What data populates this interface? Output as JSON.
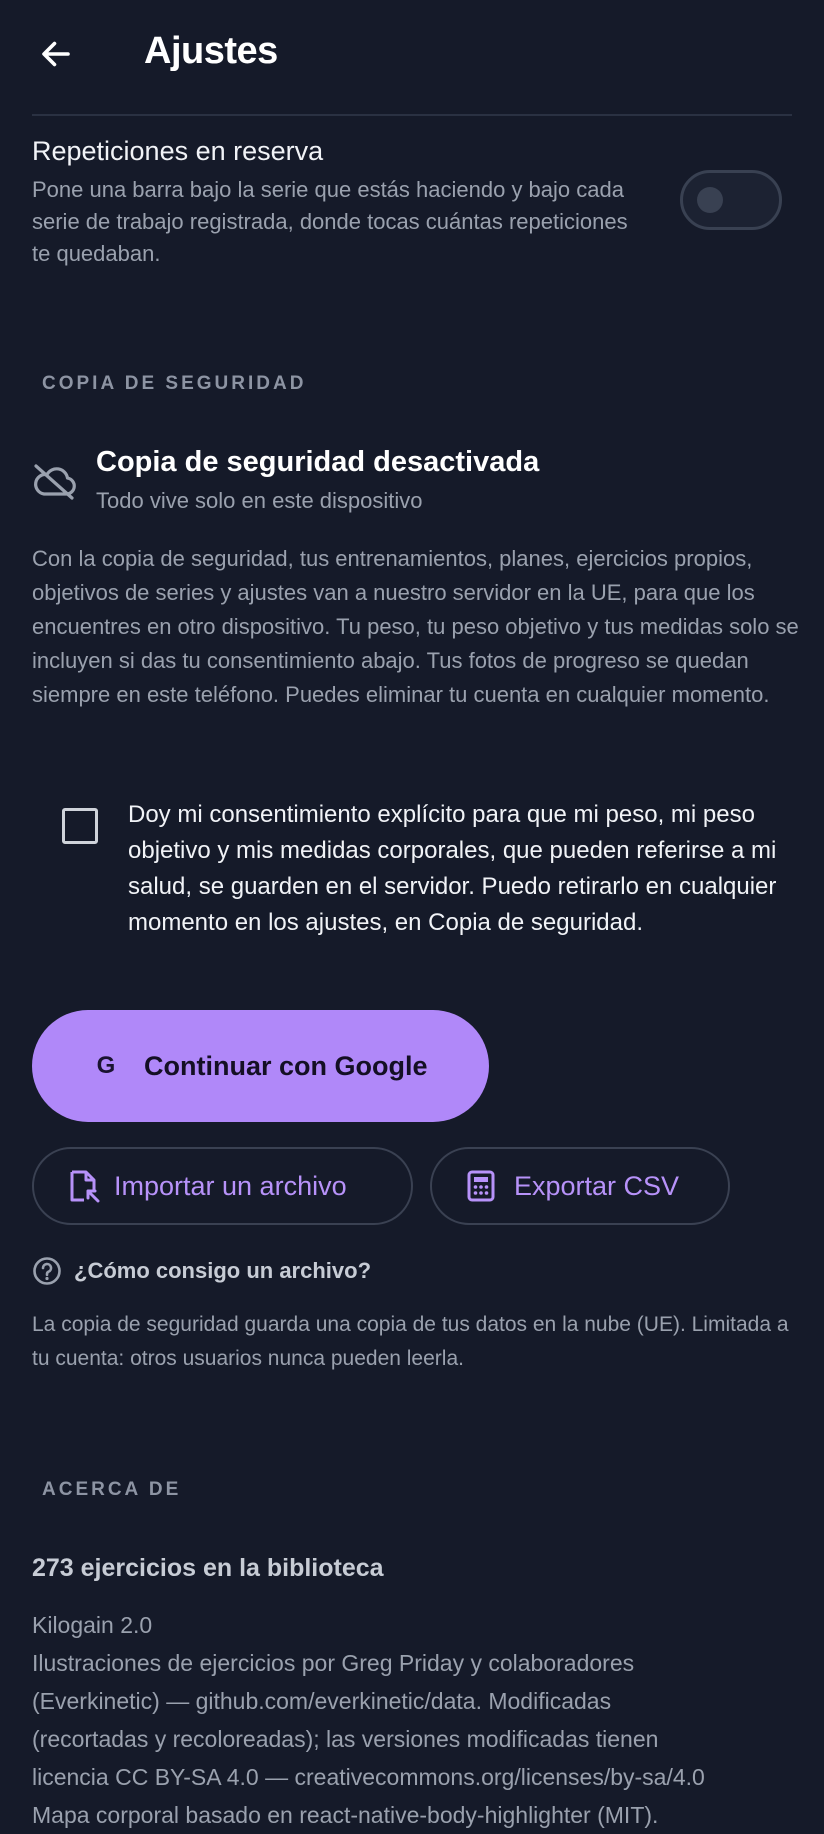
{
  "header": {
    "title": "Ajustes",
    "back_icon": "arrow-left-icon"
  },
  "rir": {
    "title": "Repeticiones en reserva",
    "description": "Pone una barra bajo la serie que estás haciendo y bajo cada serie de trabajo registrada, donde tocas cuántas repeticiones te quedaban.",
    "toggle_on": false
  },
  "backup": {
    "section_label": "COPIA DE SEGURIDAD",
    "status_icon": "cloud-off-icon",
    "status_title": "Copia de seguridad desactivada",
    "status_subtitle": "Todo vive solo en este dispositivo",
    "description": "Con la copia de seguridad, tus entrenamientos, planes, ejercicios propios, objetivos de series y ajustes van a nuestro servidor en la UE, para que los encuentres en otro dispositivo. Tu peso, tu peso objetivo y tus medidas solo se incluyen si das tu consentimiento abajo. Tus fotos de progreso se quedan siempre en este teléfono. Puedes eliminar tu cuenta en cualquier momento.",
    "consent_checked": false,
    "consent_text": "Doy mi consentimiento explícito para que mi peso, mi peso objetivo y mis medidas corporales, que pueden referirse a mi salud, se guarden en el servidor. Puedo retirarlo en cualquier momento en los ajustes, en Copia de seguridad.",
    "google_button": "Continuar con Google",
    "google_icon_glyph": "G",
    "import_button": "Importar un archivo",
    "export_button": "Exportar CSV",
    "help_link": "¿Cómo consigo un archivo?",
    "help_description": "La copia de seguridad guarda una copia de tus datos en la nube (UE). Limitada a tu cuenta: otros usuarios nunca pueden leerla."
  },
  "about": {
    "section_label": "ACERCA DE",
    "exercise_count": "273 ejercicios en la biblioteca",
    "lines": [
      "Kilogain 2.0",
      "Ilustraciones de ejercicios por Greg Priday y colaboradores",
      "(Everkinetic) — github.com/everkinetic/data. Modificadas",
      "(recortadas y recoloreadas); las versiones modificadas tienen",
      "licencia CC BY-SA 4.0 — creativecommons.org/licenses/by-sa/4.0",
      "Mapa corporal basado en react-native-body-highlighter (MIT)."
    ]
  },
  "colors": {
    "background": "#151a29",
    "accent": "#b088f9",
    "accent_text": "#b792f9",
    "muted_text": "#9aa1ae"
  }
}
